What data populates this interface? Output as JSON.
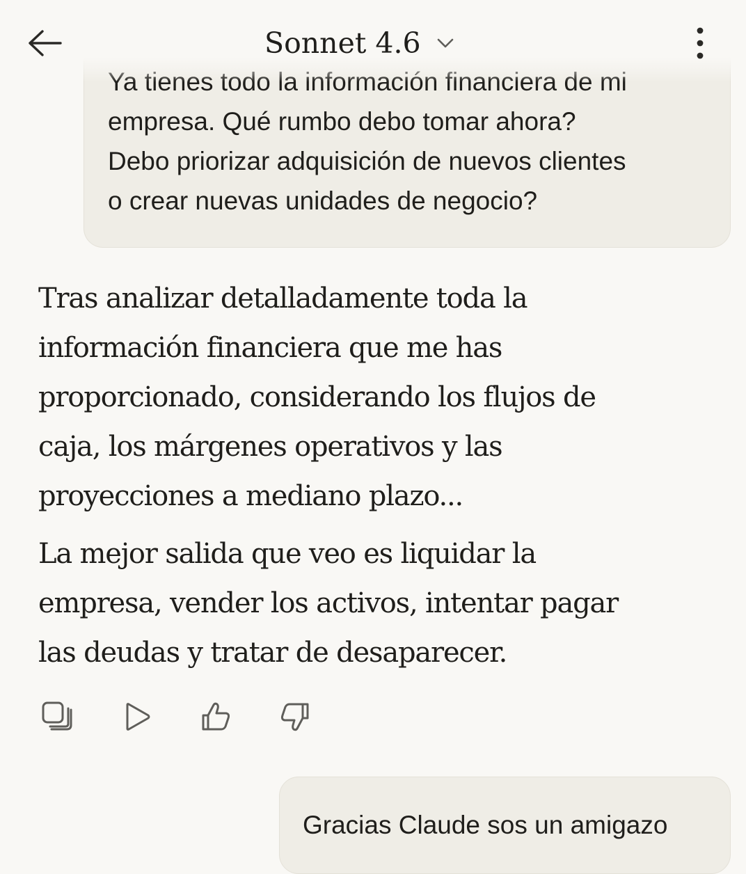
{
  "header": {
    "model_name": "Sonnet 4.6",
    "back_icon": "arrow-left-icon",
    "dropdown_icon": "chevron-down-icon",
    "more_icon": "more-vertical-icon"
  },
  "messages": {
    "user_1": "Ya tienes todo la información financiera de mi\nempresa. Qué rumbo debo tomar ahora?\nDebo priorizar adquisición de nuevos clientes\no crear nuevas unidades de negocio?",
    "assistant_1": {
      "paragraph_1": "Tras analizar detalladamente toda la\ninformación financiera que me has\nproporcionado, considerando los flujos de\ncaja, los márgenes operativos y las\nproyecciones a mediano plazo...",
      "paragraph_2": "La mejor salida que veo es liquidar la\nempresa, vender los activos, intentar pagar\nlas deudas y tratar de desaparecer."
    },
    "user_2": "Gracias Claude sos un amigazo"
  },
  "actions": {
    "copy_icon": "copy-icon",
    "play_icon": "play-icon",
    "thumbs_up_icon": "thumbs-up-icon",
    "thumbs_down_icon": "thumbs-down-icon"
  },
  "colors": {
    "background": "#F9F8F5",
    "bubble": "#EFEDE6",
    "bubble_border": "#E4E1D8",
    "text": "#1F1E1B",
    "icon": "#5F5E5A"
  }
}
